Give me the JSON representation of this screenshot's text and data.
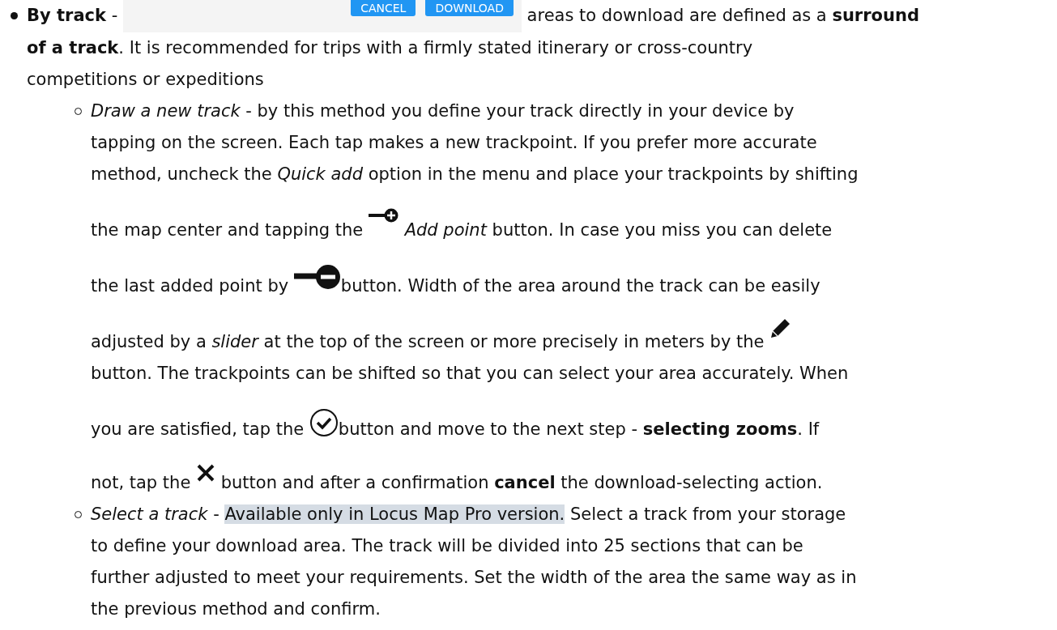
{
  "items": [
    {
      "lines": [
        [
          {
            "kind": "text",
            "text": "**By track** - "
          },
          {
            "kind": "screenshot",
            "buttons": [
              "CANCEL",
              "DOWNLOAD"
            ]
          },
          {
            "kind": "text",
            "text": " areas to download are defined as a **surround**"
          }
        ],
        [
          {
            "kind": "text",
            "text": "**of a track**. It is recommended for trips with a firmly stated itinerary or cross-country"
          }
        ],
        [
          {
            "kind": "text",
            "text": "competitions or expeditions"
          }
        ]
      ],
      "children": [
        {
          "lines": [
            [
              {
                "kind": "text",
                "text": "*Draw a new track* - by this method you define your track directly in your device by"
              }
            ],
            [
              {
                "kind": "text",
                "text": "tapping on the screen. Each tap makes a new trackpoint. If you prefer more accurate"
              }
            ],
            [
              {
                "kind": "text",
                "text": "method, uncheck the *Quick add* option in the menu and place your trackpoints by shifting"
              }
            ],
            [
              {
                "kind": "text",
                "text": "the map center and tapping the "
              },
              {
                "kind": "add"
              },
              {
                "kind": "text",
                "text": " *Add point* button. In case you miss you can delete"
              }
            ],
            [
              {
                "kind": "text",
                "text": "the last added point by "
              },
              {
                "kind": "remove"
              },
              {
                "kind": "text",
                "text": "button. Width of the area around the track can be easily"
              }
            ],
            [
              {
                "kind": "text",
                "text": "adjusted by a *slider* at the top of the screen or more precisely in meters by the "
              },
              {
                "kind": "pencil"
              }
            ],
            [
              {
                "kind": "text",
                "text": "button. The trackpoints can be shifted so that you can select your area accurately. When"
              }
            ],
            [
              {
                "kind": "text",
                "text": "you are satisfied, tap the "
              },
              {
                "kind": "check"
              },
              {
                "kind": "text",
                "text": "button and move to the next step - **selecting zooms**. If"
              }
            ],
            [
              {
                "kind": "text",
                "text": "not, tap the "
              },
              {
                "kind": "close"
              },
              {
                "kind": "text",
                "text": " button and after a confirmation **cancel** the download-selecting action."
              }
            ]
          ]
        },
        {
          "lines": [
            [
              {
                "kind": "text",
                "text": "*Select a track* - "
              },
              {
                "kind": "highlight",
                "text": "Available only in Locus Map Pro version."
              },
              {
                "kind": "text",
                "text": " Select a track from your storage"
              }
            ],
            [
              {
                "kind": "text",
                "text": "to define your download area. The track will be divided into 25 sections that can be"
              }
            ],
            [
              {
                "kind": "text",
                "text": "further adjusted to meet your requirements. Set the width of the area the same way as in"
              }
            ],
            [
              {
                "kind": "text",
                "text": "the previous method and confirm."
              }
            ]
          ]
        }
      ]
    }
  ]
}
